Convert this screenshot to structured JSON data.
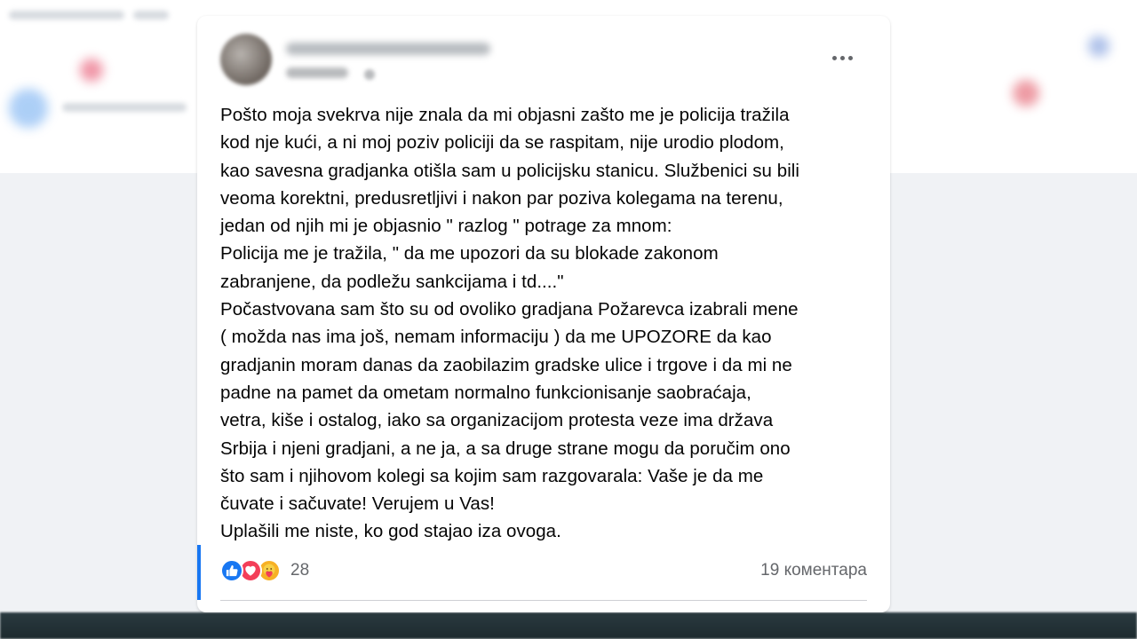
{
  "post": {
    "lines": [
      "Pošto moja svekrva nije znala da mi objasni zašto me je policija tražila",
      "kod nje kući, a ni moj poziv policiji da se raspitam, nije urodio plodom,",
      "kao savesna gradjanka otišla sam u policijsku stanicu. Službenici su bili",
      "veoma korektni, predusretljivi i nakon par poziva kolegama na terenu,",
      "jedan od njih mi je objasnio \" razlog \" potrage za mnom:",
      "Policija me je tražila, \" da me upozori da su blokade zakonom",
      "zabranjene, da podležu sankcijama i td....\"",
      "Počastvovana sam što su od ovoliko gradjana Požarevca izabrali mene",
      "( možda nas ima još, nemam informaciju ) da me UPOZORE da kao",
      "gradjanin moram danas da zaobilazim gradske ulice i trgove i da mi ne",
      "padne na pamet da ometam normalno funkcionisanje saobraćaja,",
      "vetra, kiše i ostalog, iako sa organizacijom protesta veze ima država",
      "Srbija i njeni gradjani, a ne ja, a sa druge strane mogu da poručim ono",
      "što sam i njihovom kolegi sa kojim sam razgovarala: Vaše je da me",
      "čuvate i sačuvate! Verujem u Vas!",
      "Uplašili me niste, ko god stajao iza ovoga."
    ],
    "reaction_count": "28",
    "comments_label": "19 коментара"
  },
  "icons": {
    "reactions": [
      "like-icon",
      "love-icon",
      "care-icon"
    ],
    "more": "more-options-icon"
  },
  "colors": {
    "like": "#1877f2",
    "love": "#f33e58",
    "care": "#f7b125",
    "text": "#050505",
    "muted": "#65676b"
  }
}
